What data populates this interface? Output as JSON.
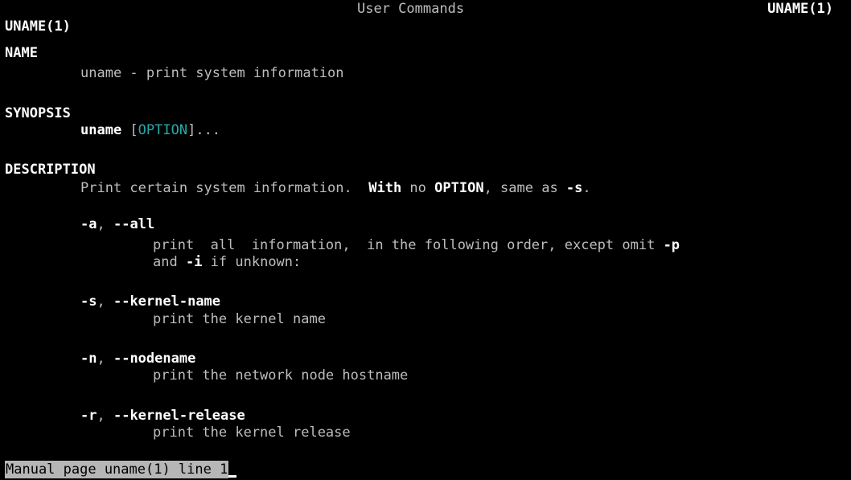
{
  "header": {
    "left": "UNAME(1)",
    "center": "User Commands",
    "right": "UNAME(1)"
  },
  "sections": {
    "name": {
      "heading": "NAME",
      "text": "uname - print system information"
    },
    "synopsis": {
      "heading": "SYNOPSIS",
      "command": "uname",
      "bracket_open": " [",
      "option": "OPTION",
      "rest": "]..."
    },
    "description": {
      "heading": "DESCRIPTION",
      "intro_prefix": "Print certain system information.  ",
      "intro_with": "With",
      "intro_no": " no ",
      "intro_option": "OPTION",
      "intro_same": ", same as ",
      "intro_flag": "-s",
      "intro_end": "."
    }
  },
  "options": [
    {
      "short": "-a",
      "sep": ", ",
      "long": "--all",
      "desc_line1_a": "print  all  information,  in the following order, except omit ",
      "desc_line1_flag": "-p",
      "desc_line2_a": "and ",
      "desc_line2_flag": "-i",
      "desc_line2_b": " if unknown:"
    },
    {
      "short": "-s",
      "sep": ", ",
      "long": "--kernel-name",
      "desc": "print the kernel name"
    },
    {
      "short": "-n",
      "sep": ", ",
      "long": "--nodename",
      "desc": "print the network node hostname"
    },
    {
      "short": "-r",
      "sep": ", ",
      "long": "--kernel-release",
      "desc": "print the kernel release"
    }
  ],
  "status_bar": {
    "text": "Manual page uname(1) line 1"
  },
  "colors": {
    "background": "#000000",
    "normal_text": "#bdbdbd",
    "bold_text": "#ffffff",
    "underline_text": "#27a9a7",
    "status_bg": "#b6b6b6",
    "status_fg": "#000000"
  }
}
